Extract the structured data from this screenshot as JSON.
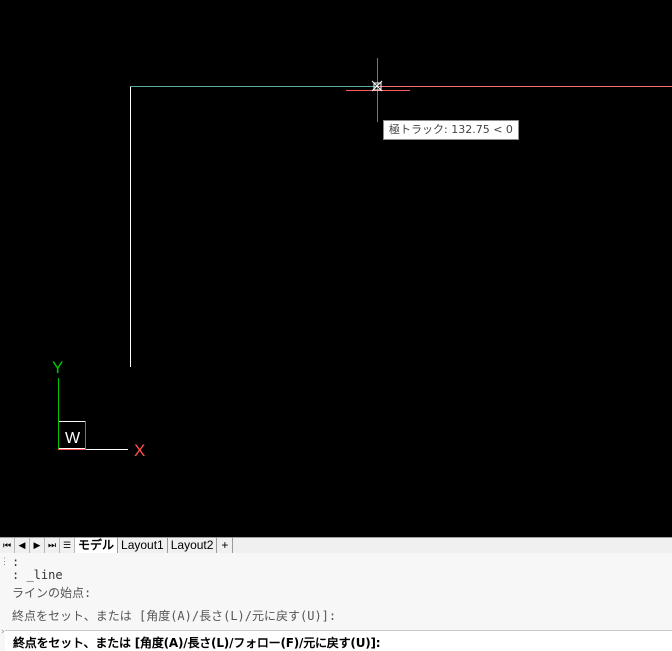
{
  "canvas": {
    "background": "#000000",
    "tooltip_text": "極トラック: 132.75 < 0",
    "ucs": {
      "y_label": "Y",
      "x_label": "X",
      "w_label": "W"
    },
    "colors": {
      "drawn_line": "#ffffff",
      "tracking_line": "#5aa8a0",
      "tracking_extension": "#ff6e6e",
      "crosshair_x": "#ff5a5a",
      "crosshair_y": "#00c800",
      "ucs_x": "#ff5050",
      "ucs_y": "#00c800"
    }
  },
  "tabbar": {
    "nav_icons": [
      "first-icon",
      "prev-icon",
      "next-icon",
      "last-icon"
    ],
    "tabs": [
      {
        "label": "モデル",
        "active": true
      },
      {
        "label": "Layout1",
        "active": false
      },
      {
        "label": "Layout2",
        "active": false
      }
    ],
    "add_tab_label": "+"
  },
  "command": {
    "history": [
      ":",
      ": _line",
      "ラインの始点:",
      "終点をセット、または [角度(A)/長さ(L)/元に戻す(U)]:"
    ],
    "current_prompt": "終点をセット、または [角度(A)/長さ(L)/フォロー(F)/元に戻す(U)]:"
  }
}
